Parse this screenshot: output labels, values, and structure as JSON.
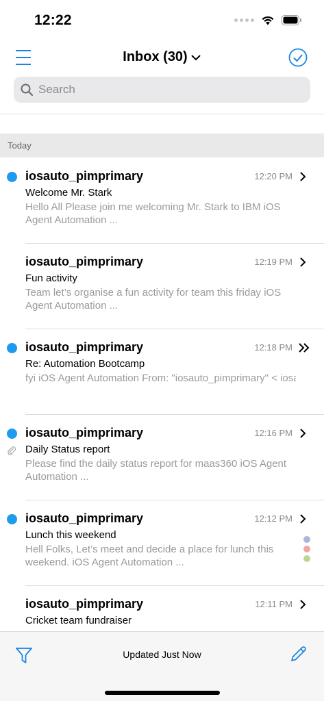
{
  "status_bar": {
    "time": "12:22"
  },
  "header": {
    "title": "Inbox (30)"
  },
  "search": {
    "placeholder": "Search"
  },
  "section": {
    "label": "Today"
  },
  "emails": [
    {
      "sender": "iosauto_pimprimary",
      "time": "12:20 PM",
      "subject": "Welcome Mr. Stark",
      "preview": "Hello All Please join me welcoming Mr. Stark to IBM iOS Agent Automation  ...",
      "unread": true,
      "arrow": "chevron-right-icon"
    },
    {
      "sender": "iosauto_pimprimary",
      "time": "12:19 PM",
      "subject": "Fun activity",
      "preview": "Team let’s organise a fun activity for team this friday iOS Agent Automation  ...",
      "unread": false,
      "arrow": "chevron-right-icon"
    },
    {
      "sender": "iosauto_pimprimary",
      "time": "12:18 PM",
      "subject": "Re: Automation Bootcamp",
      "preview": "fyi iOS Agent Automation From: \"iosauto_pimprimary\" < iosauto_pimprimary@ios...",
      "unread": true,
      "arrow": "double-chevron-right-icon"
    },
    {
      "sender": "iosauto_pimprimary",
      "time": "12:16 PM",
      "subject": "Daily Status report",
      "preview": "Please find the daily status report for maas360 iOS Agent Automation  ...",
      "unread": true,
      "attachment": true,
      "arrow": "chevron-right-icon"
    },
    {
      "sender": "iosauto_pimprimary",
      "time": "12:12 PM",
      "subject": "Lunch this weekend",
      "preview": "Hell Folks, Let’s meet and decide a place for lunch this weekend. iOS Agent Automation  ...",
      "unread": true,
      "tags": [
        "#a9b8d8",
        "#f2a7a7",
        "#b8da8e"
      ],
      "arrow": "chevron-right-icon"
    },
    {
      "sender": "iosauto_pimprimary",
      "time": "12:11 PM",
      "subject": "Cricket team fundraiser",
      "preview": "",
      "unread": false,
      "arrow": "chevron-right-icon"
    }
  ],
  "footer": {
    "status": "Updated Just Now"
  },
  "colors": {
    "accent": "#1c84e0",
    "unread_dot": "#1c9bf0"
  }
}
